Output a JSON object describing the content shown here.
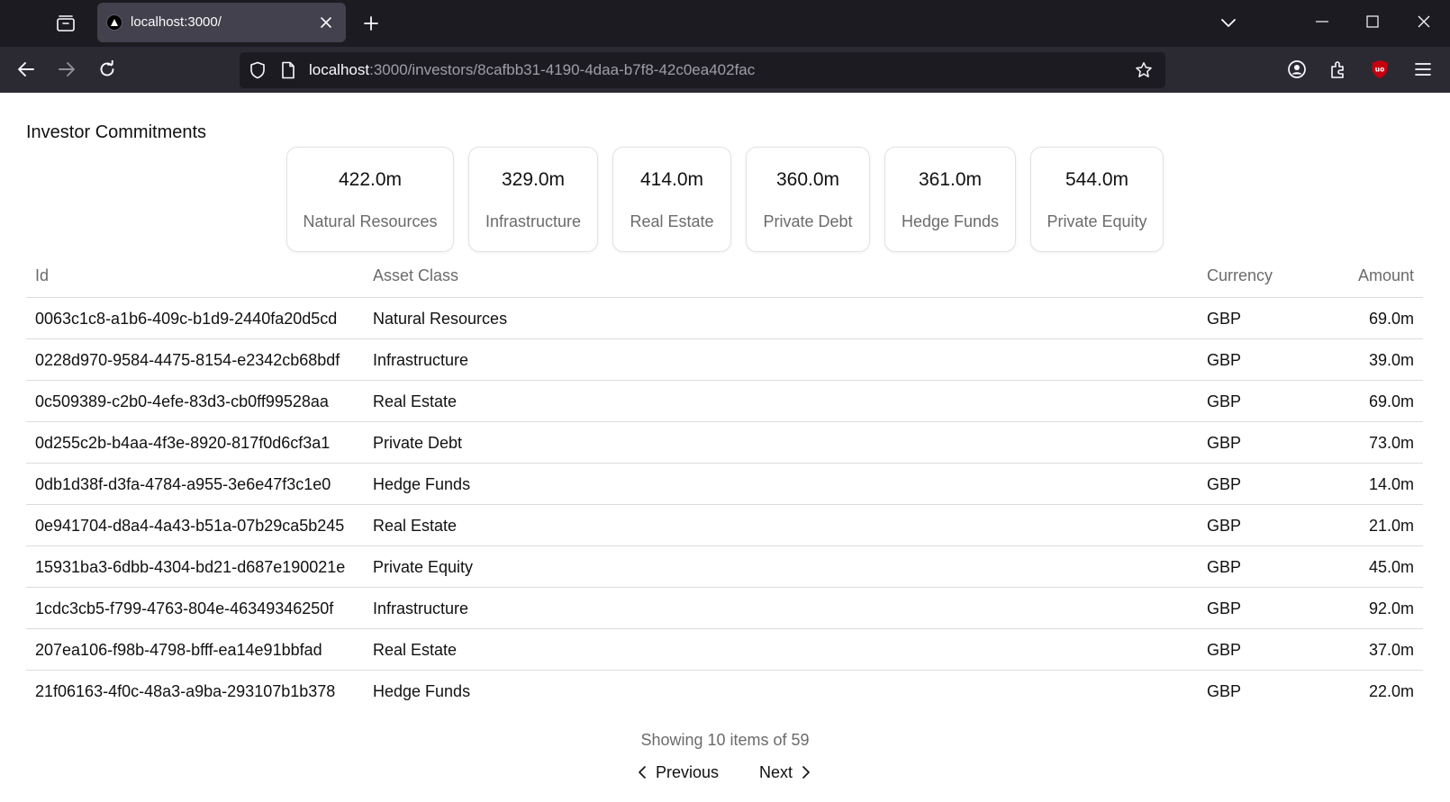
{
  "browser": {
    "tab": {
      "title": "localhost:3000/"
    },
    "url": {
      "host": "localhost",
      "rest": ":3000/investors/8cafbb31-4190-4daa-b7f8-42c0ea402fac"
    },
    "icons": {
      "tab_list": "tab-list-icon",
      "favicon": "triangle-favicon-icon",
      "close": "close-icon",
      "new_tab": "plus-icon",
      "overflow": "chevron-down-icon",
      "minimize": "minimize-icon",
      "maximize": "maximize-icon",
      "window_close": "window-close-icon",
      "back": "back-arrow-icon",
      "forward": "forward-arrow-icon",
      "reload": "reload-icon",
      "tracking": "shield-icon",
      "page_info": "page-icon",
      "bookmark": "star-icon",
      "account": "account-icon",
      "extensions": "puzzle-icon",
      "ublock": "ublock-icon",
      "menu": "hamburger-menu-icon"
    },
    "colors": {
      "tab_bar": "#1c1b22",
      "nav_bar": "#2b2a33",
      "ublock": "#c4000f"
    }
  },
  "page": {
    "title": "Investor Commitments",
    "summary_cards": [
      {
        "value": "422.0m",
        "label": "Natural Resources"
      },
      {
        "value": "329.0m",
        "label": "Infrastructure"
      },
      {
        "value": "414.0m",
        "label": "Real Estate"
      },
      {
        "value": "360.0m",
        "label": "Private Debt"
      },
      {
        "value": "361.0m",
        "label": "Hedge Funds"
      },
      {
        "value": "544.0m",
        "label": "Private Equity"
      }
    ],
    "table": {
      "headers": {
        "id": "Id",
        "asset_class": "Asset Class",
        "currency": "Currency",
        "amount": "Amount"
      },
      "rows": [
        {
          "id": "0063c1c8-a1b6-409c-b1d9-2440fa20d5cd",
          "asset_class": "Natural Resources",
          "currency": "GBP",
          "amount": "69.0m"
        },
        {
          "id": "0228d970-9584-4475-8154-e2342cb68bdf",
          "asset_class": "Infrastructure",
          "currency": "GBP",
          "amount": "39.0m"
        },
        {
          "id": "0c509389-c2b0-4efe-83d3-cb0ff99528aa",
          "asset_class": "Real Estate",
          "currency": "GBP",
          "amount": "69.0m"
        },
        {
          "id": "0d255c2b-b4aa-4f3e-8920-817f0d6cf3a1",
          "asset_class": "Private Debt",
          "currency": "GBP",
          "amount": "73.0m"
        },
        {
          "id": "0db1d38f-d3fa-4784-a955-3e6e47f3c1e0",
          "asset_class": "Hedge Funds",
          "currency": "GBP",
          "amount": "14.0m"
        },
        {
          "id": "0e941704-d8a4-4a43-b51a-07b29ca5b245",
          "asset_class": "Real Estate",
          "currency": "GBP",
          "amount": "21.0m"
        },
        {
          "id": "15931ba3-6dbb-4304-bd21-d687e190021e",
          "asset_class": "Private Equity",
          "currency": "GBP",
          "amount": "45.0m"
        },
        {
          "id": "1cdc3cb5-f799-4763-804e-46349346250f",
          "asset_class": "Infrastructure",
          "currency": "GBP",
          "amount": "92.0m"
        },
        {
          "id": "207ea106-f98b-4798-bfff-ea14e91bbfad",
          "asset_class": "Real Estate",
          "currency": "GBP",
          "amount": "37.0m"
        },
        {
          "id": "21f06163-4f0c-48a3-a9ba-293107b1b378",
          "asset_class": "Hedge Funds",
          "currency": "GBP",
          "amount": "22.0m"
        }
      ]
    },
    "pagination": {
      "status": "Showing 10 items of 59",
      "previous_label": "Previous",
      "next_label": "Next",
      "previous_icon": "chevron-left-icon",
      "next_icon": "chevron-right-icon"
    }
  }
}
